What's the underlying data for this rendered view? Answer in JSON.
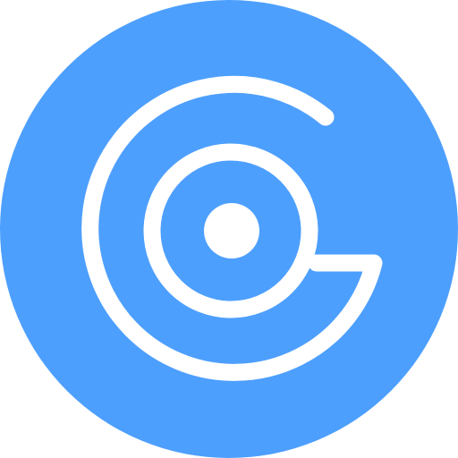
{
  "icon": {
    "name": "spiral-target-logo",
    "colors": {
      "background": "#4d9ffd",
      "foreground": "#ffffff",
      "page": "#ffffff"
    }
  }
}
